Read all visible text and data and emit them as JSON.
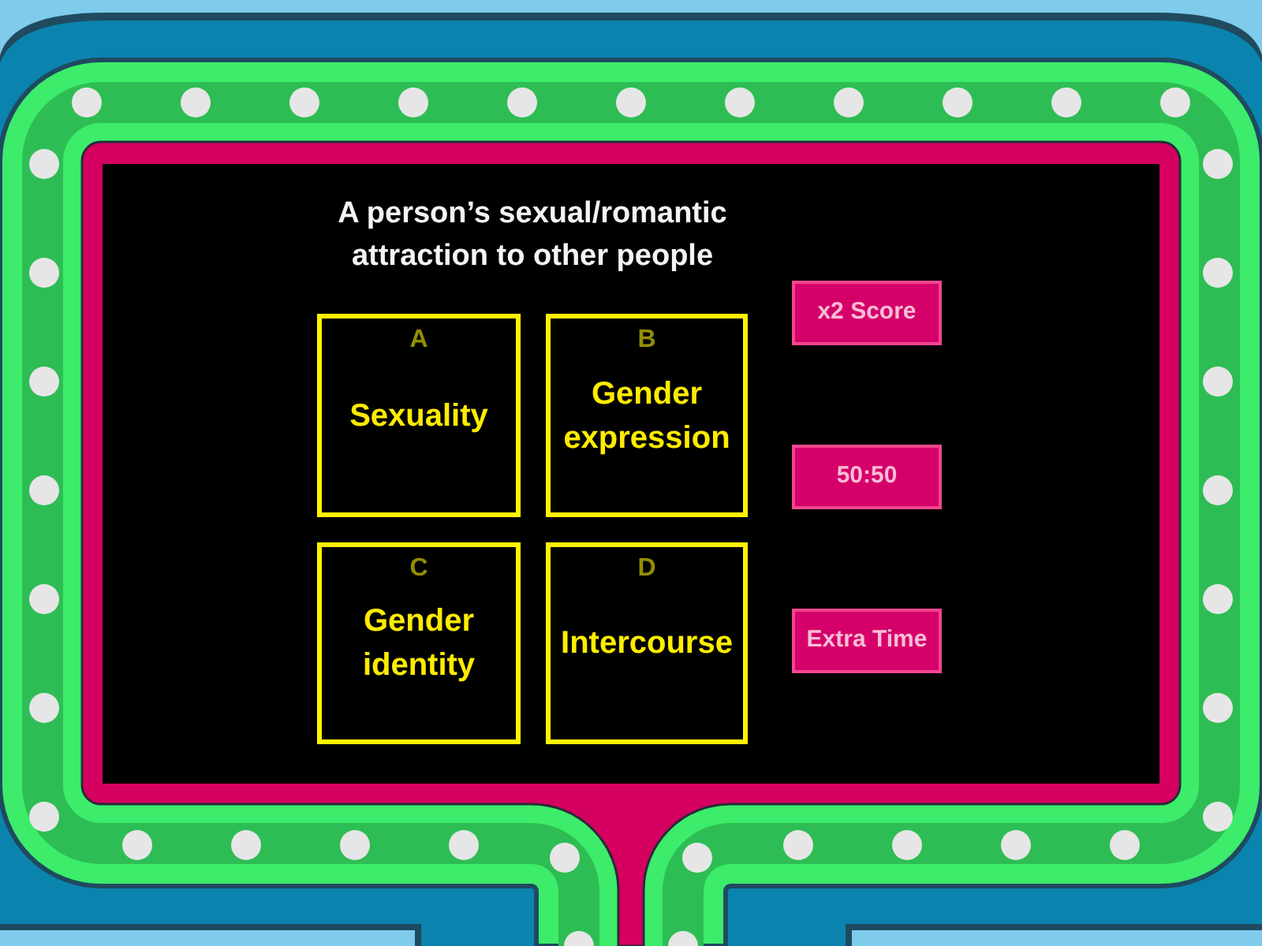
{
  "question": "A person’s sexual/romantic attraction to other people",
  "answers": [
    {
      "letter": "A",
      "text": "Sexuality"
    },
    {
      "letter": "B",
      "text": "Gender expression"
    },
    {
      "letter": "C",
      "text": "Gender identity"
    },
    {
      "letter": "D",
      "text": "Intercourse"
    }
  ],
  "power_ups": [
    {
      "label": "x2 Score"
    },
    {
      "label": "50:50"
    },
    {
      "label": "Extra Time"
    }
  ]
}
